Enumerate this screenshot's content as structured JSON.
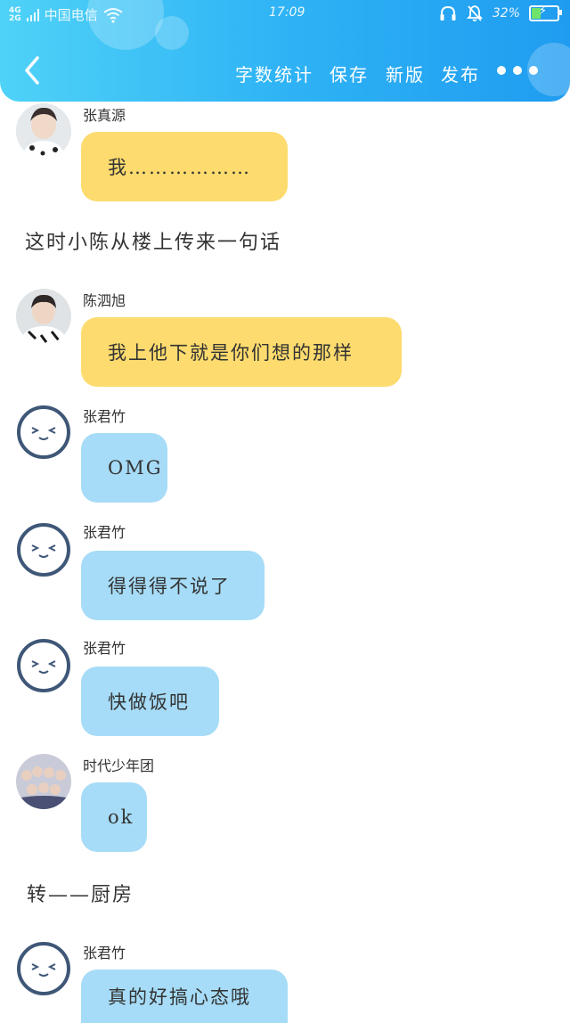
{
  "status_bar": {
    "network_top": "4G",
    "network_bottom": "2G",
    "carrier": "中国电信",
    "time": "17:09",
    "battery": "32%",
    "battery_level": 0.32
  },
  "nav": {
    "word_count": "字数统计",
    "save": "保存",
    "new_version": "新版",
    "publish": "发布"
  },
  "messages": [
    {
      "sender": "张真源",
      "text": "我………………",
      "style": "yellow",
      "avatar": "photo-avatar"
    },
    {
      "narration": "这时小陈从楼上传来一句话"
    },
    {
      "sender": "陈泗旭",
      "text": "我上他下就是你们想的那样",
      "style": "yellow",
      "avatar": "photo-avatar"
    },
    {
      "sender": "张君竹",
      "text": "OMG",
      "style": "blue",
      "avatar": "smiley-avatar"
    },
    {
      "sender": "张君竹",
      "text": "得得得不说了",
      "style": "blue",
      "avatar": "smiley-avatar"
    },
    {
      "sender": "张君竹",
      "text": "快做饭吧",
      "style": "blue",
      "avatar": "smiley-avatar"
    },
    {
      "sender": "时代少年团",
      "text": "ok",
      "style": "blue",
      "avatar": "group-photo-avatar"
    },
    {
      "narration": "转——厨房"
    },
    {
      "sender": "张君竹",
      "text": "真的好搞心态哦",
      "style": "blue",
      "avatar": "smiley-avatar"
    }
  ],
  "colors": {
    "header_start": "#4fd2f7",
    "header_end": "#1f9cf0",
    "bubble_yellow": "#fddb6e",
    "bubble_blue": "#a6dcf7"
  }
}
